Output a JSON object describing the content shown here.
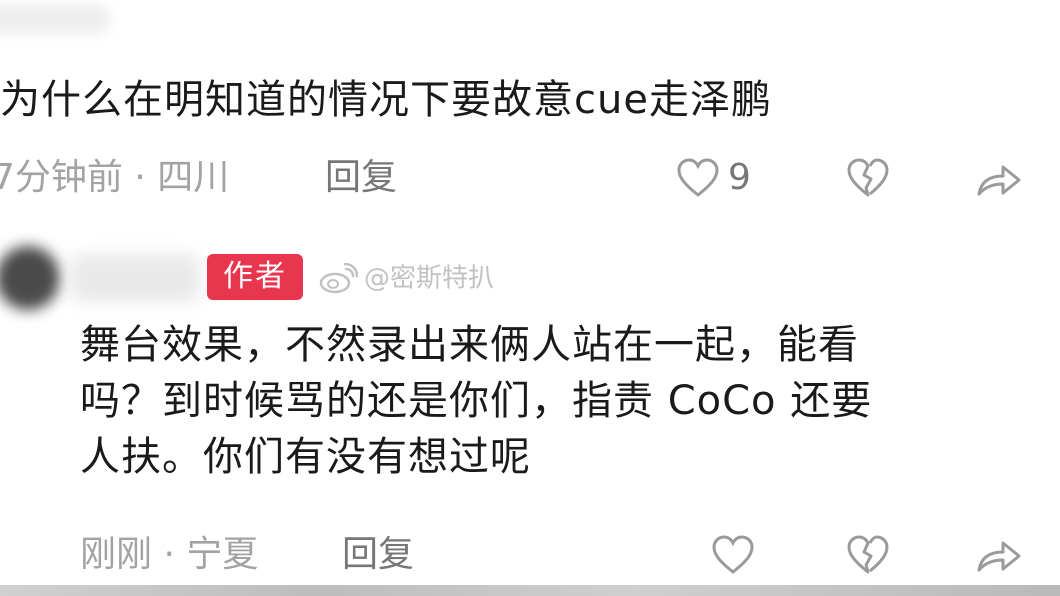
{
  "comment": {
    "text": "为什么在明知道的情况下要故意cue走泽鹏",
    "time": "7分钟前",
    "location": "四川",
    "meta_sep": "·",
    "reply_label": "回复",
    "like_count": "9",
    "icons": [
      "heart-icon",
      "broken-heart-icon",
      "share-icon"
    ]
  },
  "author_reply": {
    "badge": "作者",
    "watermark": "@密斯特扒",
    "lines": [
      "舞台效果，不然录出来俩人站在一起，能看",
      "吗？到时候骂的还是你们，指责 CoCo 还要",
      "人扶。你们有没有想过呢"
    ],
    "time": "刚刚",
    "location": "宁夏",
    "meta_sep": "·",
    "reply_label": "回复",
    "icons": [
      "heart-icon",
      "broken-heart-icon",
      "share-icon"
    ]
  },
  "colors": {
    "badge": "#e8364f",
    "meta_text": "#a3a3a3",
    "icon": "#9a9a9a"
  }
}
